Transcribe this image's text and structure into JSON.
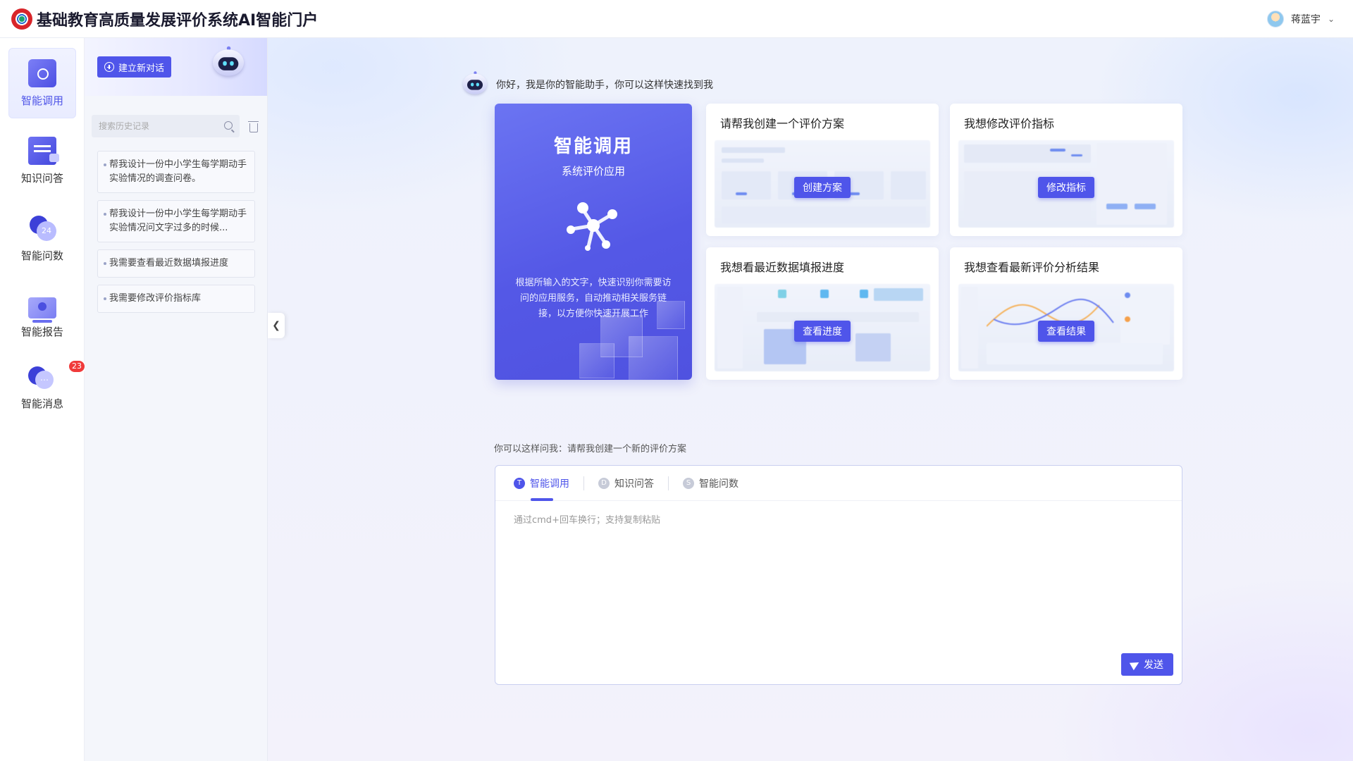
{
  "app": {
    "title": "基础教育高质量发展评价系统AI智能门户"
  },
  "user": {
    "name": "蒋蓝宇"
  },
  "rail": {
    "items": [
      {
        "label": "智能调用",
        "icon": "smart-call-icon",
        "active": true
      },
      {
        "label": "知识问答",
        "icon": "knowledge-qa-icon"
      },
      {
        "label": "智能问数",
        "icon": "smart-data-icon",
        "icon_text": "24"
      },
      {
        "label": "智能报告",
        "icon": "smart-report-icon"
      },
      {
        "label": "智能消息",
        "icon": "smart-message-icon",
        "badge": "23"
      }
    ]
  },
  "history": {
    "new_chat_label": "建立新对话",
    "search_placeholder": "搜索历史记录",
    "items": [
      "帮我设计一份中小学生每学期动手实验情况的调查问卷。",
      "帮我设计一份中小学生每学期动手实验情况问文字过多的时候...",
      "我需要查看最近数据填报进度",
      "我需要修改评价指标库"
    ]
  },
  "main": {
    "greeting": "你好，我是你的智能助手，你可以这样快速找到我",
    "hero": {
      "title": "智能调用",
      "subtitle": "系统评价应用",
      "description": "根据所输入的文字，快速识别你需要访问的应用服务，自动推动相关服务链接，以方便你快速开展工作"
    },
    "cards": [
      {
        "title": "请帮我创建一个评价方案",
        "button": "创建方案"
      },
      {
        "title": "我想修改评价指标",
        "button": "修改指标"
      },
      {
        "title": "我想看最近数据填报进度",
        "button": "查看进度"
      },
      {
        "title": "我想查看最新评价分析结果",
        "button": "查看结果"
      }
    ],
    "suggestion": "你可以这样问我：请帮我创建一个新的评价方案",
    "composer": {
      "tabs": [
        {
          "icon_letter": "T",
          "label": "智能调用",
          "active": true
        },
        {
          "icon_letter": "D",
          "label": "知识问答"
        },
        {
          "icon_letter": "S",
          "label": "智能问数"
        }
      ],
      "placeholder": "通过cmd+回车换行；支持复制粘贴",
      "send_label": "发送"
    }
  },
  "colors": {
    "accent": "#4f55ea",
    "badge": "#f03a3a"
  }
}
